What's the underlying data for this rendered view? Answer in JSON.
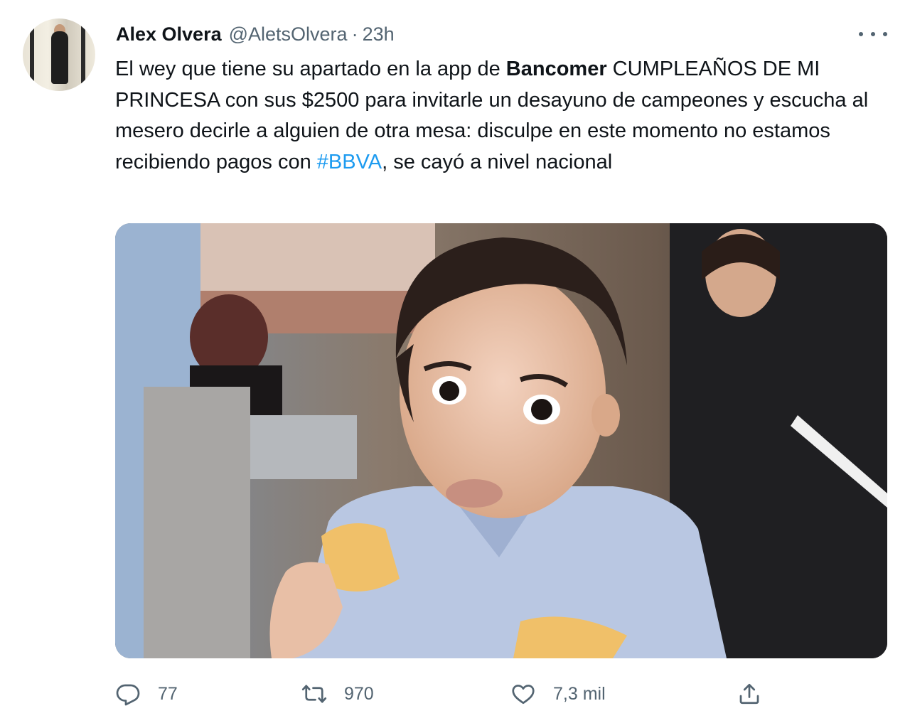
{
  "tweet": {
    "author": {
      "name": "Alex Olvera",
      "handle": "@AletsOlvera",
      "separator": "·",
      "time": "23h"
    },
    "text": {
      "part1": "El wey que tiene su apartado en la app de ",
      "bold": "Bancomer",
      "part2": " CUMPLEAÑOS DE MI PRINCESA con sus $2500 para invitarle un desayuno de campeones y escucha al mesero decirle a alguien de otra mesa: disculpe en este momento no estamos recibiendo pagos con ",
      "hashtag": "#BBVA",
      "part3": ", se cayó a nivel nacional"
    },
    "actions": {
      "replies": "77",
      "retweets": "970",
      "likes": "7,3 mil"
    },
    "icons": {
      "more": "more-icon",
      "reply": "reply-icon",
      "retweet": "retweet-icon",
      "like": "heart-icon",
      "share": "share-icon"
    },
    "colors": {
      "text": "#0f1419",
      "secondary": "#536471",
      "link": "#1d9bf0"
    }
  }
}
